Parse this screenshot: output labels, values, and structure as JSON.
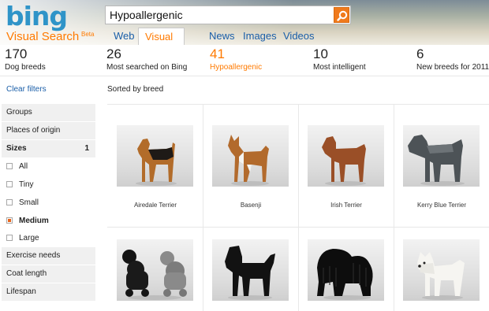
{
  "logo": {
    "text": "bing"
  },
  "vertical": {
    "title": "Visual Search",
    "badge": "Beta"
  },
  "search": {
    "value": "Hypoallergenic",
    "button_icon": "search-icon"
  },
  "tabs": [
    {
      "label": "Web",
      "active": false
    },
    {
      "label": "Visual Search",
      "active": true
    },
    {
      "label": "News",
      "active": false
    },
    {
      "label": "Images",
      "active": false
    },
    {
      "label": "Videos",
      "active": false
    }
  ],
  "stats": [
    {
      "num": "170",
      "label": "Dog breeds",
      "active": false
    },
    {
      "num": "26",
      "label": "Most searched on Bing",
      "active": false
    },
    {
      "num": "41",
      "label": "Hypoallergenic",
      "active": true
    },
    {
      "num": "10",
      "label": "Most intelligent",
      "active": false
    },
    {
      "num": "6",
      "label": "New breeds for 2011",
      "active": false
    }
  ],
  "sidebar": {
    "clear_filters": "Clear filters",
    "groups": "Groups",
    "places": "Places of origin",
    "sizes": {
      "label": "Sizes",
      "count": "1"
    },
    "size_options": [
      {
        "label": "All",
        "checked": false
      },
      {
        "label": "Tiny",
        "checked": false
      },
      {
        "label": "Small",
        "checked": false
      },
      {
        "label": "Medium",
        "checked": true
      },
      {
        "label": "Large",
        "checked": false
      }
    ],
    "exercise": "Exercise needs",
    "coat": "Coat length",
    "lifespan": "Lifespan"
  },
  "results": {
    "sorted_by": "Sorted by breed",
    "row1": [
      "Airedale Terrier",
      "Basenji",
      "Irish Terrier",
      "Kerry Blue Terrier"
    ]
  },
  "colors": {
    "accent": "#ff7a00",
    "link": "#1a5ea8",
    "brand": "#2f94c8"
  }
}
